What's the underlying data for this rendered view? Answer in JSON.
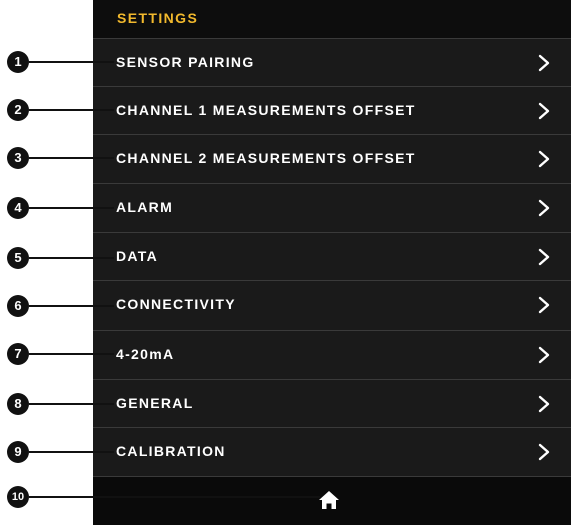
{
  "header": {
    "title": "SETTINGS"
  },
  "menu": [
    {
      "label": "SENSOR PAIRING"
    },
    {
      "label": "CHANNEL 1 MEASUREMENTS OFFSET"
    },
    {
      "label": "CHANNEL 2 MEASUREMENTS OFFSET"
    },
    {
      "label": "ALARM"
    },
    {
      "label": "DATA"
    },
    {
      "label": "CONNECTIVITY"
    },
    {
      "label": "4-20mA"
    },
    {
      "label": "GENERAL"
    },
    {
      "label": "CALIBRATION"
    }
  ],
  "callouts": [
    "1",
    "2",
    "3",
    "4",
    "5",
    "6",
    "7",
    "8",
    "9",
    "10"
  ],
  "icons": {
    "row_arrow": "chevron-right-icon",
    "footer": "home-icon"
  },
  "colors": {
    "accent": "#f2b92d",
    "background": "#1a1a1a",
    "text": "#ffffff"
  }
}
